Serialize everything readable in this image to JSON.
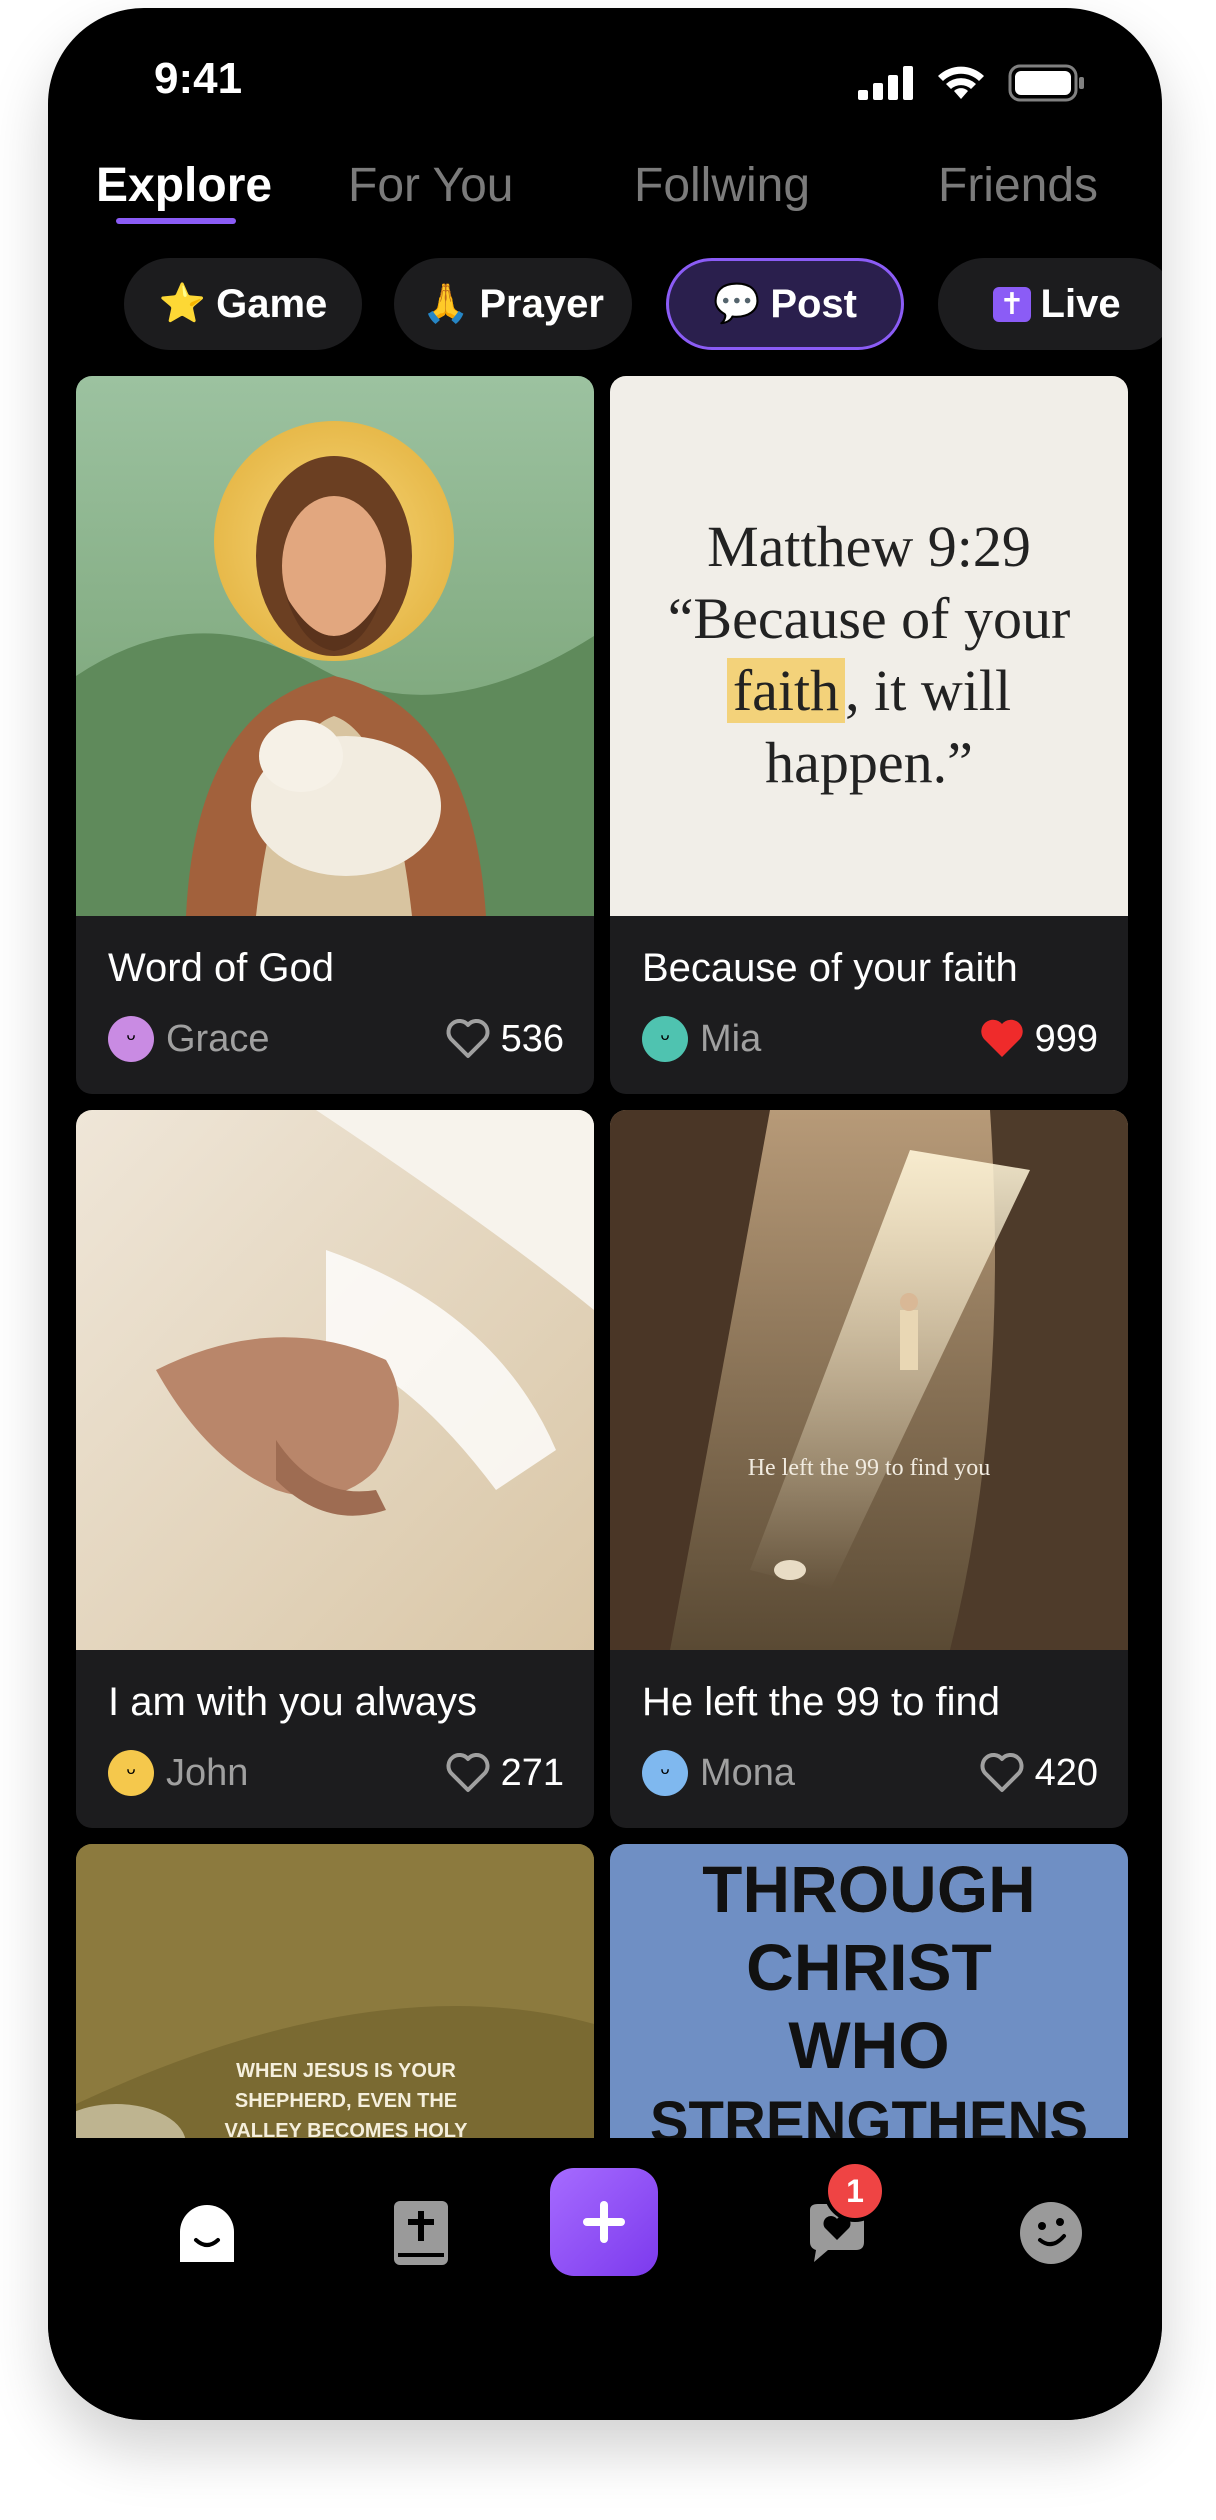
{
  "status_bar": {
    "time": "9:41"
  },
  "tabs": [
    {
      "label": "Explore"
    },
    {
      "label": "For You"
    },
    {
      "label": "Follwing"
    },
    {
      "label": "Friends"
    }
  ],
  "chips": [
    {
      "emoji": "⭐",
      "label": "Game"
    },
    {
      "emoji": "🙏",
      "label": "Prayer"
    },
    {
      "emoji": "💬",
      "label": "Post"
    },
    {
      "emoji": "✝",
      "label": "Live"
    }
  ],
  "posts": [
    {
      "title": "Word of God",
      "user": "Grace",
      "likes": "536",
      "liked": false
    },
    {
      "title": "Because of your faith",
      "user": "Mia",
      "likes": "999",
      "liked": true,
      "verse": {
        "ref": "Matthew 9:29",
        "line1": "“Because of your",
        "highlight": "faith",
        "line2_rest": ", it will",
        "line3": "happen.”"
      }
    },
    {
      "title": "I am with you always",
      "user": "John",
      "likes": "271",
      "liked": false
    },
    {
      "title": "He left the 99 to find",
      "user": "Mona",
      "likes": "420",
      "liked": false,
      "image_caption": "He left the 99 to find you"
    },
    {
      "image_caption": "WHEN JESUS IS YOUR SHEPHERD, EVEN THE VALLEY BECOMES HOLY GROUND."
    },
    {
      "image_text": [
        "THROUGH",
        "CHRIST",
        "WHO",
        "STRENGTHENS"
      ]
    }
  ],
  "bottom_nav": {
    "messages_badge": "1"
  },
  "colors": {
    "accent": "#8b5cf6",
    "like_red": "#ef2b2b",
    "card_bg": "#1c1c1e"
  }
}
